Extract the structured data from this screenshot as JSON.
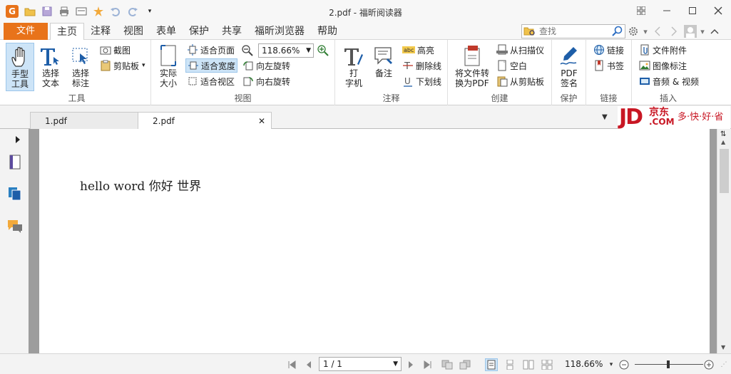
{
  "window": {
    "title": "2.pdf - 福昕阅读器",
    "logo_letter": "G"
  },
  "menu": {
    "file": "文件",
    "tabs": [
      "主页",
      "注释",
      "视图",
      "表单",
      "保护",
      "共享",
      "福昕浏览器",
      "帮助"
    ],
    "active_tab": "主页",
    "search_placeholder": "查找"
  },
  "ribbon": {
    "tools": {
      "label": "工具",
      "hand": "手型\n工具",
      "select_text": "选择\n文本",
      "select_annot": "选择\n标注",
      "screenshot": "截图",
      "clipboard": "剪贴板"
    },
    "view": {
      "label": "视图",
      "actual_size": "实际\n大小",
      "fit_page": "适合页面",
      "fit_width": "适合宽度",
      "fit_visible": "适合视区",
      "zoom_value": "118.66%",
      "rotate_left": "向左旋转",
      "rotate_right": "向右旋转"
    },
    "comment": {
      "label": "注释",
      "typewriter": "打\n字机",
      "note": "备注",
      "highlight": "高亮",
      "strikeout": "删除线",
      "underline": "下划线"
    },
    "create": {
      "label": "创建",
      "convert": "将文件转\n换为PDF",
      "from_scanner": "从扫描仪",
      "blank": "空白",
      "from_clipboard": "从剪贴板"
    },
    "protect": {
      "label": "保护",
      "sign": "PDF\n签名"
    },
    "links": {
      "label": "链接",
      "link": "链接",
      "bookmark": "书签"
    },
    "insert": {
      "label": "插入",
      "attachment": "文件附件",
      "image": "图像标注",
      "media": "音频 & 视频"
    }
  },
  "doc_tabs": [
    {
      "name": "1.pdf",
      "active": false
    },
    {
      "name": "2.pdf",
      "active": true
    }
  ],
  "ad": {
    "jd": "JD",
    "cn": "京东",
    "com": ".COM",
    "slogan": "多·快·好·省"
  },
  "document": {
    "text": "hello word 你好 世界"
  },
  "status": {
    "page": "1 / 1",
    "zoom": "118.66%"
  }
}
